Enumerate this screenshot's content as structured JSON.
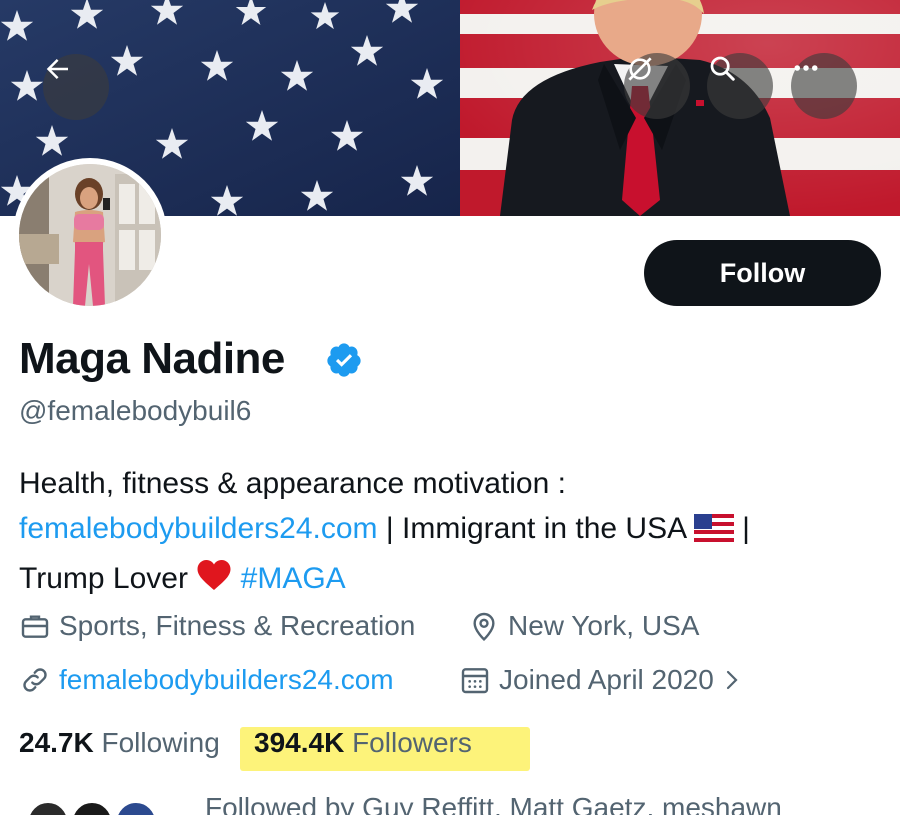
{
  "header": {
    "back_icon": "arrow-left-icon",
    "translate_icon": "translate-icon",
    "search_icon": "search-icon",
    "more_icon": "more-horizontal-icon"
  },
  "profile": {
    "display_name": "Maga Nadine",
    "handle": "@femalebodybuil6",
    "verified": true,
    "follow_label": "Follow"
  },
  "bio": {
    "line1": "Health, fitness & appearance motivation :",
    "line2_link": "femalebodybuilders24.com",
    "line2_sep": " | ",
    "line2_text": "Immigrant in the USA",
    "line2_end": " |",
    "line3_text": "Trump Lover",
    "line3_hashtag": "#MAGA"
  },
  "meta": {
    "category": "Sports, Fitness & Recreation",
    "location": "New York, USA",
    "website": "femalebodybuilders24.com",
    "joined": "Joined April 2020"
  },
  "stats": {
    "following_count": "24.7K",
    "following_label": " Following",
    "followers_count": "394.4K",
    "followers_label": " Followers"
  },
  "followed_by": {
    "text": "Followed by Guy Reffitt, Matt Gaetz, meshawn"
  },
  "colors": {
    "accent": "#1d9bf0",
    "text": "#0f1419",
    "muted": "#536471",
    "highlight": "#fdf37a"
  }
}
